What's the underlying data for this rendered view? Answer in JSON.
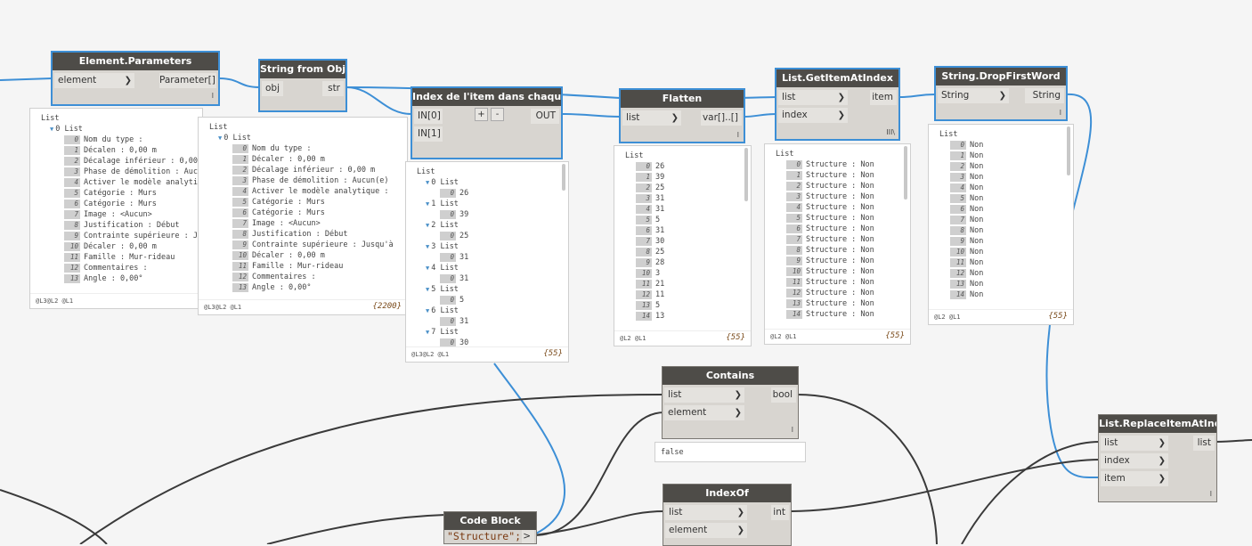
{
  "colors": {
    "wire_selected": "#3d8fd6",
    "wire": "#3a3a3a",
    "node_header": "#4e4c48",
    "node_body": "#d8d5d0",
    "canvas": "#f5f5f5"
  },
  "nodes": {
    "element_parameters": {
      "title": "Element.Parameters",
      "in": [
        "element"
      ],
      "out": [
        "Parameter[]"
      ],
      "lacing": "l",
      "preview": {
        "root": "List",
        "sub": "0 List",
        "items": [
          "Nom du type :",
          "Décalen : 0,00 m",
          "Décalage inférieur : 0,00",
          "Phase de démolition : Auc",
          "Activer le modèle analyti",
          "Catégorie : Murs",
          "Catégorie : Murs",
          "Image : <Aucun>",
          "Justification : Début",
          "Contrainte supérieure : J",
          "Décaler : 0,00 m",
          "Famille : Mur-rideau",
          "Commentaires :",
          "Angle : 0,00°"
        ],
        "levels": "@L3@L2 @L1"
      }
    },
    "string_from_object": {
      "title": "String from Object",
      "in": [
        "obj"
      ],
      "out": [
        "str"
      ],
      "preview": {
        "root": "List",
        "sub": "0 List",
        "items": [
          "Nom du type :",
          "Décaler : 0,00 m",
          "Décalage inférieur : 0,00 m",
          "Phase de démolition : Aucun(e)",
          "Activer le modèle analytique :",
          "Catégorie : Murs",
          "Catégorie : Murs",
          "Image : <Aucun>",
          "Justification : Début",
          "Contrainte supérieure : Jusqu'à",
          "Décaler : 0,00 m",
          "Famille : Mur-rideau",
          "Commentaires :",
          "Angle : 0,00°"
        ],
        "levels": "@L3@L2 @L1",
        "count": "{2200}"
      }
    },
    "index_item": {
      "title": "Index de l'item dans chaque liste",
      "in": [
        "IN[0]",
        "IN[1]"
      ],
      "out": [
        "OUT"
      ],
      "plus": "+",
      "minus": "-",
      "preview": {
        "root": "List",
        "groups": [
          {
            "l": "0 List",
            "v": "26"
          },
          {
            "l": "1 List",
            "v": "39"
          },
          {
            "l": "2 List",
            "v": "25"
          },
          {
            "l": "3 List",
            "v": "31"
          },
          {
            "l": "4 List",
            "v": "31"
          },
          {
            "l": "5 List",
            "v": "5"
          },
          {
            "l": "6 List",
            "v": "31"
          },
          {
            "l": "7 List",
            "v": "30"
          }
        ],
        "levels": "@L3@L2 @L1",
        "count": "{55}"
      }
    },
    "flatten": {
      "title": "Flatten",
      "in": [
        "list"
      ],
      "out": [
        "var[]..[]"
      ],
      "lacing": "l",
      "preview": {
        "root": "List",
        "values": [
          "26",
          "39",
          "25",
          "31",
          "31",
          "5",
          "31",
          "30",
          "25",
          "28",
          "3",
          "21",
          "11",
          "5",
          "13"
        ],
        "levels": "@L2 @L1",
        "count": "{55}"
      }
    },
    "get_item": {
      "title": "List.GetItemAtIndex",
      "in": [
        "list",
        "index"
      ],
      "out": [
        "item"
      ],
      "lacing": "III\\",
      "preview": {
        "root": "List",
        "values": [
          "Structure : Non",
          "Structure : Non",
          "Structure : Non",
          "Structure : Non",
          "Structure : Non",
          "Structure : Non",
          "Structure : Non",
          "Structure : Non",
          "Structure : Non",
          "Structure : Non",
          "Structure : Non",
          "Structure : Non",
          "Structure : Non",
          "Structure : Non",
          "Structure : Non"
        ],
        "levels": "@L2 @L1",
        "count": "{55}"
      }
    },
    "drop_first": {
      "title": "String.DropFirstWord",
      "in": [
        "String"
      ],
      "out": [
        "String"
      ],
      "lacing": "l",
      "preview": {
        "root": "List",
        "values": [
          "Non",
          "Non",
          "Non",
          "Non",
          "Non",
          "Non",
          "Non",
          "Non",
          "Non",
          "Non",
          "Non",
          "Non",
          "Non",
          "Non",
          "Non"
        ],
        "levels": "@L2 @L1",
        "count": "{55}"
      }
    },
    "contains": {
      "title": "Contains",
      "in": [
        "list",
        "element"
      ],
      "out": [
        "bool"
      ],
      "lacing": "l",
      "preview": "false"
    },
    "indexof": {
      "title": "IndexOf",
      "in": [
        "list",
        "element"
      ],
      "out": [
        "int"
      ]
    },
    "replace": {
      "title": "List.ReplaceItemAtIndex",
      "in": [
        "list",
        "index",
        "item"
      ],
      "out": [
        "list"
      ],
      "lacing": "l"
    },
    "codeblock": {
      "title": "Code Block",
      "code": "\"Structure\";",
      "out": ">"
    }
  }
}
